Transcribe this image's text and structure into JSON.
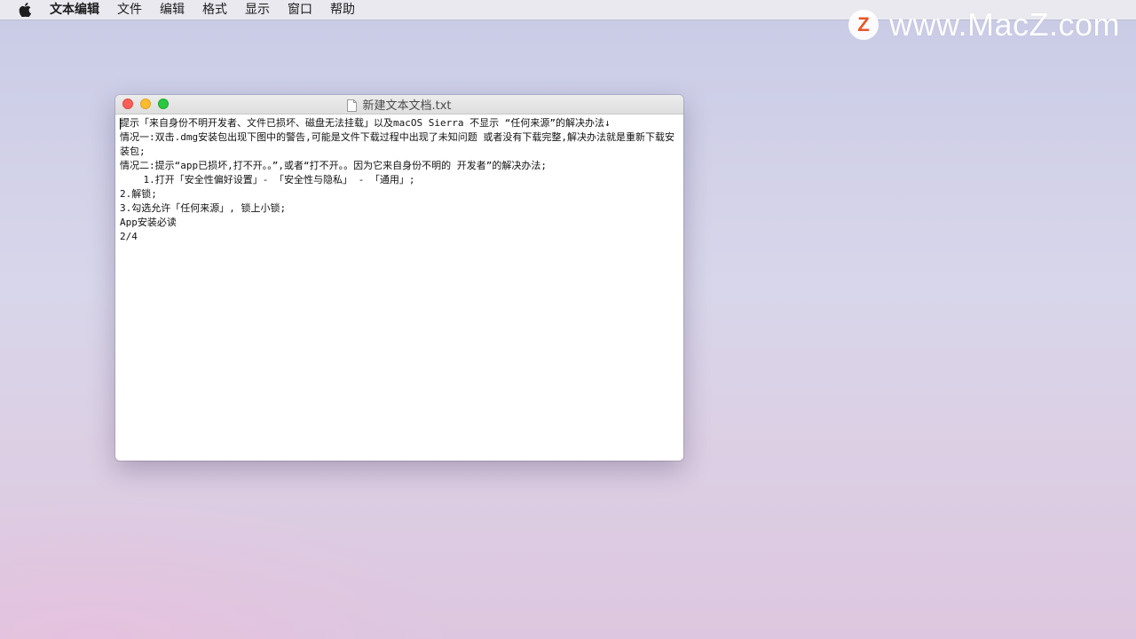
{
  "menubar": {
    "apple_icon": "apple-icon",
    "items": [
      "文本编辑",
      "文件",
      "编辑",
      "格式",
      "显示",
      "窗口",
      "帮助"
    ]
  },
  "watermark": {
    "logo_letter": "Z",
    "text": "www.MacZ.com"
  },
  "window": {
    "title": "新建文本文档.txt",
    "title_icon": "text-document-icon",
    "lines": [
      "提示「来自身份不明开发者、文件已损坏、磁盘无法挂载」以及macOS Sierra 不显示 “任何来源”的解决办法↓",
      "情况一:双击.dmg安装包出现下图中的警告,可能是文件下载过程中出现了未知问题 或者没有下载完整,解决办法就是重新下载安装包;",
      "情况二:提示“app已损坏,打不开。。”,或者“打不开。。因为它来自身份不明的 开发者”的解决办法;",
      "    1.打开「安全性偏好设置」- 「安全性与隐私」 - 「通用」;",
      "2.解锁;",
      "3.勾选允许「任何来源」, 锁上小锁;",
      "App安装必读",
      "2/4"
    ]
  },
  "colors": {
    "close": "#fc5f57",
    "minimize": "#fdbc2e",
    "zoom": "#28c840",
    "watermark_logo": "#e8562a"
  }
}
